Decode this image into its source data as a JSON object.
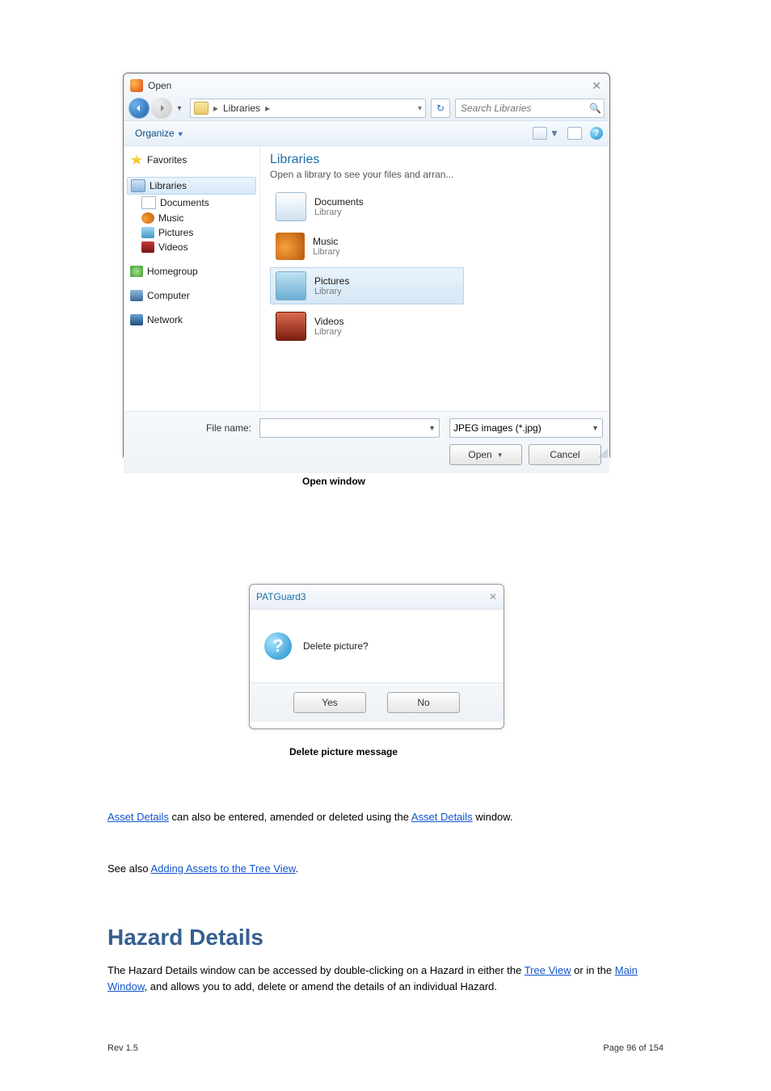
{
  "open_dialog": {
    "title": "Open",
    "breadcrumb": {
      "item": "Libraries"
    },
    "search_placeholder": "Search Libraries",
    "toolbar": {
      "organize": "Organize"
    },
    "tree": {
      "favorites": "Favorites",
      "libraries": "Libraries",
      "documents": "Documents",
      "music": "Music",
      "pictures": "Pictures",
      "videos": "Videos",
      "homegroup": "Homegroup",
      "computer": "Computer",
      "network": "Network"
    },
    "content": {
      "heading": "Libraries",
      "sub": "Open a library to see your files and arran...",
      "items": [
        {
          "title": "Documents",
          "sub": "Library"
        },
        {
          "title": "Music",
          "sub": "Library"
        },
        {
          "title": "Pictures",
          "sub": "Library"
        },
        {
          "title": "Videos",
          "sub": "Library"
        }
      ]
    },
    "footer": {
      "file_name_label": "File name:",
      "file_type": "JPEG images (*.jpg)",
      "open_btn": "Open",
      "cancel_btn": "Cancel"
    }
  },
  "caption_open": "Open window",
  "confirm_dialog": {
    "title": "PATGuard3",
    "message": "Delete picture?",
    "yes": "Yes",
    "no": "No"
  },
  "caption_confirm": "Delete picture message",
  "para1_a": "Asset Details",
  "para1_b": " can also be entered, amended or deleted using the ",
  "para1_c": "Asset Details",
  "para1_d": " window.",
  "para2_a": "See also ",
  "para2_b": "Adding Assets to the Tree View",
  "para2_c": ".",
  "heading": "Hazard Details",
  "para3_a": "The Hazard Details window can be accessed by double-clicking on a Hazard in either the ",
  "para3_b": "Tree View",
  "para3_c": " or in the ",
  "para3_d": "Main Window",
  "para3_e": ", and allows you to add, delete or amend the details of an individual Hazard.",
  "footer_left": "Rev 1.5",
  "footer_right": "Page 96 of 154"
}
